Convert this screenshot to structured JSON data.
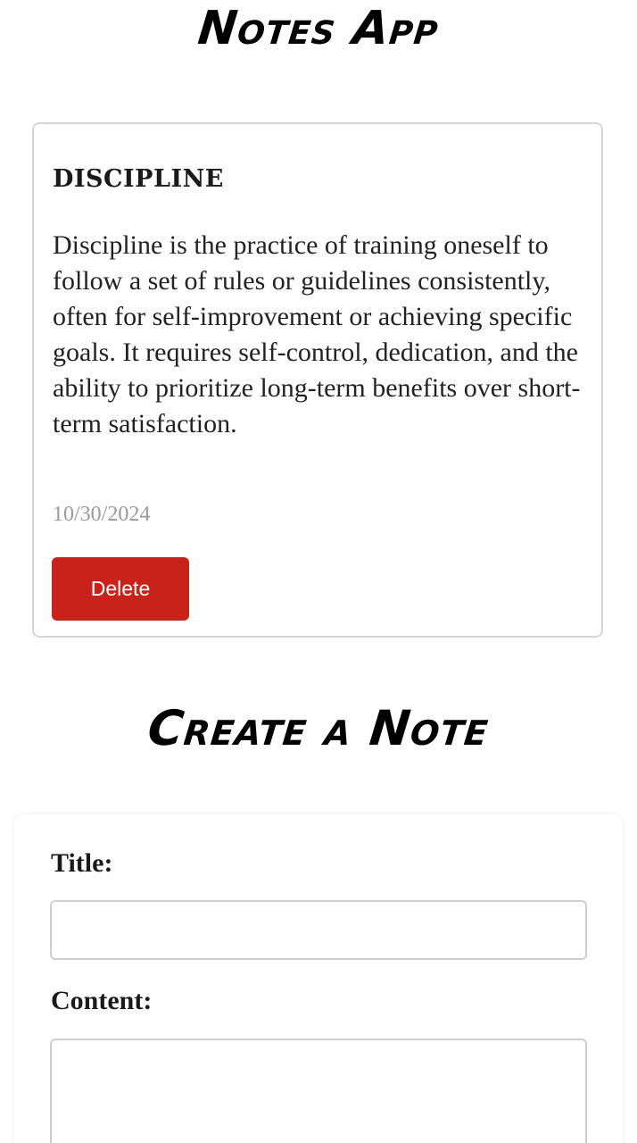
{
  "header": {
    "title": "Notes App"
  },
  "notes": [
    {
      "title": "DISCIPLINE",
      "content": "Discipline is the practice of training oneself to follow a set of rules or guidelines consistently, often for self-improvement or achieving specific goals. It requires self-control, dedication, and the ability to prioritize long-term benefits over short-term satisfaction.",
      "date": "10/30/2024",
      "delete_label": "Delete"
    }
  ],
  "create": {
    "heading": "Create a Note",
    "title_label": "Title:",
    "title_value": "",
    "content_label": "Content:",
    "content_value": ""
  },
  "colors": {
    "delete_button": "#c9221a",
    "date_text": "#9a9a9a",
    "card_border": "#d6d6d6"
  }
}
